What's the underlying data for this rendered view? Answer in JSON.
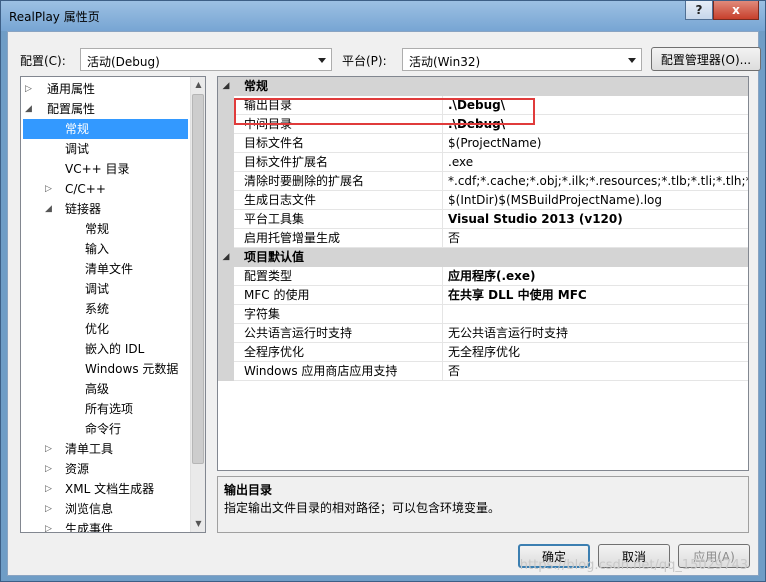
{
  "window": {
    "title": "RealPlay 属性页",
    "help_btn": "?",
    "close_btn": "x"
  },
  "config": {
    "label": "配置(C):",
    "value": "活动(Debug)",
    "platform_label": "平台(P):",
    "platform_value": "活动(Win32)",
    "manager_button": "配置管理器(O)..."
  },
  "tree": [
    {
      "label": "通用属性",
      "level": 0,
      "toggle": "▷"
    },
    {
      "label": "配置属性",
      "level": 0,
      "toggle": "◢"
    },
    {
      "label": "常规",
      "level": 1,
      "selected": true
    },
    {
      "label": "调试",
      "level": 1
    },
    {
      "label": "VC++ 目录",
      "level": 1
    },
    {
      "label": "C/C++",
      "level": 1,
      "toggle": "▷"
    },
    {
      "label": "链接器",
      "level": 1,
      "toggle": "◢"
    },
    {
      "label": "常规",
      "level": 2
    },
    {
      "label": "输入",
      "level": 2
    },
    {
      "label": "清单文件",
      "level": 2
    },
    {
      "label": "调试",
      "level": 2
    },
    {
      "label": "系统",
      "level": 2
    },
    {
      "label": "优化",
      "level": 2
    },
    {
      "label": "嵌入的 IDL",
      "level": 2
    },
    {
      "label": "Windows 元数据",
      "level": 2
    },
    {
      "label": "高级",
      "level": 2
    },
    {
      "label": "所有选项",
      "level": 2
    },
    {
      "label": "命令行",
      "level": 2
    },
    {
      "label": "清单工具",
      "level": 1,
      "toggle": "▷"
    },
    {
      "label": "资源",
      "level": 1,
      "toggle": "▷"
    },
    {
      "label": "XML 文档生成器",
      "level": 1,
      "toggle": "▷"
    },
    {
      "label": "浏览信息",
      "level": 1,
      "toggle": "▷"
    },
    {
      "label": "生成事件",
      "level": 1,
      "toggle": "▷"
    }
  ],
  "sections": [
    {
      "title": "常规",
      "rows": [
        {
          "name": "输出目录",
          "value": ".\\Debug\\",
          "bold": true
        },
        {
          "name": "中间目录",
          "value": ".\\Debug\\",
          "bold": true
        },
        {
          "name": "目标文件名",
          "value": "$(ProjectName)"
        },
        {
          "name": "目标文件扩展名",
          "value": ".exe"
        },
        {
          "name": "清除时要删除的扩展名",
          "value": "*.cdf;*.cache;*.obj;*.ilk;*.resources;*.tlb;*.tli;*.tlh;*.tmp;"
        },
        {
          "name": "生成日志文件",
          "value": "$(IntDir)$(MSBuildProjectName).log"
        },
        {
          "name": "平台工具集",
          "value": "Visual Studio 2013 (v120)",
          "bold": true
        },
        {
          "name": "启用托管增量生成",
          "value": "否"
        }
      ]
    },
    {
      "title": "项目默认值",
      "rows": [
        {
          "name": "配置类型",
          "value": "应用程序(.exe)",
          "bold": true
        },
        {
          "name": "MFC 的使用",
          "value": "在共享 DLL 中使用 MFC",
          "bold": true
        },
        {
          "name": "字符集",
          "value": ""
        },
        {
          "name": "公共语言运行时支持",
          "value": "无公共语言运行时支持"
        },
        {
          "name": "全程序优化",
          "value": "无全程序优化"
        },
        {
          "name": "Windows 应用商店应用支持",
          "value": "否"
        }
      ]
    }
  ],
  "description": {
    "title": "输出目录",
    "text": "指定输出文件目录的相对路径；可以包含环境变量。"
  },
  "buttons": {
    "ok": "确定",
    "cancel": "取消",
    "apply": "应用(A)"
  },
  "watermark": "https://blog.csdn.net/qq_15029743"
}
